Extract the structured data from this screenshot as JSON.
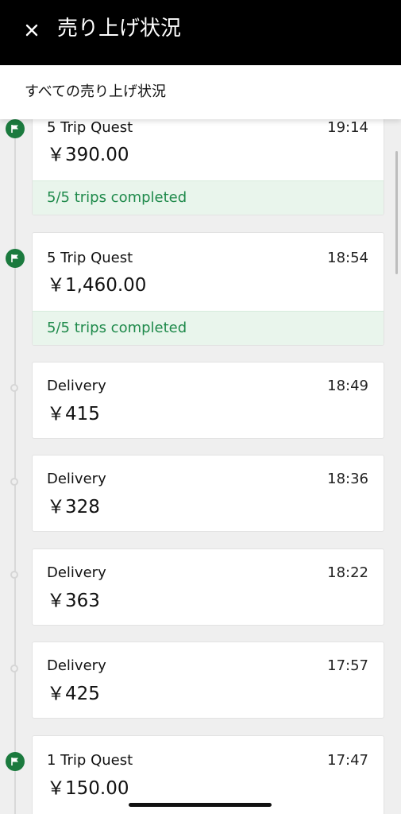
{
  "header": {
    "title": "売り上げ状況",
    "close_icon": "close-icon"
  },
  "subheader": {
    "label": "すべての売り上げ状況"
  },
  "colors": {
    "header_bg": "#000000",
    "flag_green": "#1b7a3e",
    "completed_bg": "#e9f5ec",
    "completed_text": "#1f8a4b"
  },
  "entries": [
    {
      "name": "5 Trip Quest",
      "time": "19:14",
      "amount": "￥390.00",
      "status": "5/5 trips completed",
      "icon": "flag-icon"
    },
    {
      "name": "5 Trip Quest",
      "time": "18:54",
      "amount": "￥1,460.00",
      "status": "5/5 trips completed",
      "icon": "flag-icon"
    },
    {
      "name": "Delivery",
      "time": "18:49",
      "amount": "￥415"
    },
    {
      "name": "Delivery",
      "time": "18:36",
      "amount": "￥328"
    },
    {
      "name": "Delivery",
      "time": "18:22",
      "amount": "￥363"
    },
    {
      "name": "Delivery",
      "time": "17:57",
      "amount": "￥425"
    },
    {
      "name": "1 Trip Quest",
      "time": "17:47",
      "amount": "￥150.00",
      "icon": "flag-icon"
    }
  ]
}
